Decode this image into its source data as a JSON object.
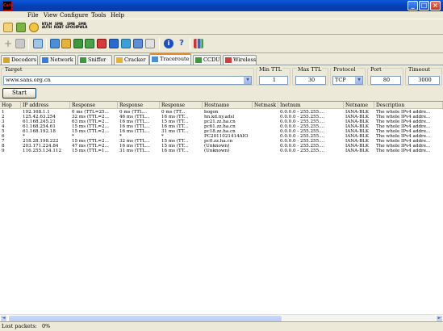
{
  "app": {
    "icon_text": "Cain"
  },
  "window_controls": {
    "minimize": "_",
    "maximize": "□",
    "close": "×"
  },
  "menu": [
    "File",
    "View",
    "Configure",
    "Tools",
    "Help"
  ],
  "toolbar": {
    "small_labels": {
      "hash_top": "NTLM",
      "hash_bottom": "AUTH",
      "sniff_top": "SMB",
      "sniff_bottom": "RDBT",
      "smb_top": "SMB",
      "smb_bottom": "SPOOF",
      "smb2_top": "SMB",
      "smb2_bottom": "PWLR"
    }
  },
  "tabs": [
    {
      "label": "Decoders",
      "icon": "decoder-icon"
    },
    {
      "label": "Network",
      "icon": "network-icon"
    },
    {
      "label": "Sniffer",
      "icon": "sniffer-icon"
    },
    {
      "label": "Cracker",
      "icon": "cracker-icon"
    },
    {
      "label": "Traceroute",
      "icon": "traceroute-icon"
    },
    {
      "label": "CCDU",
      "icon": "ccdu-icon"
    },
    {
      "label": "Wireless",
      "icon": "wireless-icon"
    }
  ],
  "active_tab": "Traceroute",
  "form": {
    "target_label": "Target",
    "target_value": "www.sans.org.cn",
    "min_ttl_label": "Min TTL",
    "min_ttl_value": "1",
    "max_ttl_label": "Max TTL",
    "max_ttl_value": "30",
    "protocol_label": "Protocol",
    "protocol_value": "TCP",
    "port_label": "Port",
    "port_value": "80",
    "timeout_label": "Timeout",
    "timeout_value": "3000",
    "start_label": "Start"
  },
  "table": {
    "columns": [
      "Hop",
      "IP address",
      "Response",
      "Response",
      "Response",
      "Hostname",
      "Netmask",
      "Inetnum",
      "Netname",
      "Description"
    ],
    "rows": [
      [
        "1",
        "192.168.1.1",
        "0 ms (TTL=25...",
        "0 ms (TTL...",
        "0 ms (TT...",
        "bogon",
        "",
        "0.0.0.0 - 255.255....",
        "IANA-BLK",
        "The whole IPv4 addre..."
      ],
      [
        "2",
        "125.42.63.254",
        "32 ms (TTL=2...",
        "46 ms (TTL...",
        "16 ms (TT...",
        "hn.kd.ny.adsl",
        "",
        "0.0.0.0 - 255.255....",
        "IANA-BLK",
        "The whole IPv4 addre..."
      ],
      [
        "3",
        "61.168.245.21",
        "63 ms (TTL=2...",
        "16 ms (TTL...",
        "15 ms (TT...",
        "pc21.zz.ha.cn",
        "",
        "0.0.0.0 - 255.255....",
        "IANA-BLK",
        "The whole IPv4 addre..."
      ],
      [
        "4",
        "61.168.254.61",
        "15 ms (TTL=2...",
        "16 ms (TTL...",
        "16 ms (TT...",
        "pc61.zz.ha.cn",
        "",
        "0.0.0.0 - 255.255....",
        "IANA-BLK",
        "The whole IPv4 addre..."
      ],
      [
        "5",
        "61.168.192.18",
        "15 ms (TTL=2...",
        "16 ms (TTL...",
        "31 ms (TT...",
        "pc18.zz.ha.cn",
        "",
        "0.0.0.0 - 255.255....",
        "IANA-BLK",
        "The whole IPv4 addre..."
      ],
      [
        "6",
        "*",
        "*",
        "*",
        "*",
        "PC2011021414AIO",
        "",
        "0.0.0.0 - 255.255....",
        "IANA-BLK",
        "The whole IPv4 addre..."
      ],
      [
        "7",
        "218.28.198.222",
        "15 ms (TTL=2...",
        "32 ms (TTL...",
        "15 ms (TT...",
        "pc0.zz.ha.cn",
        "",
        "0.0.0.0 - 255.255....",
        "IANA-BLK",
        "The whole IPv4 addre..."
      ],
      [
        "8",
        "203.171.224.84",
        "47 ms (TTL=2...",
        "16 ms (TTL...",
        "15 ms (TT...",
        "(Unknown)",
        "",
        "0.0.0.0 - 255.255....",
        "IANA-BLK",
        "The whole IPv4 addre..."
      ],
      [
        "9",
        "116.255.134.112",
        "15 ms (TTL=1...",
        "31 ms (TTL...",
        "16 ms (TT...",
        "(Unknown)",
        "",
        "0.0.0.0 - 255.255....",
        "IANA-BLK",
        "The whole IPv4 addre..."
      ]
    ]
  },
  "scroll": {
    "left": "◄",
    "right": "►"
  },
  "status": {
    "lost_packets_label": "Lost packets:",
    "lost_packets_value": "0%"
  },
  "colors": {
    "title_bar": "#0840b8",
    "accent_tab": "#e68b2c",
    "panel_bg": "#ece9d8"
  }
}
